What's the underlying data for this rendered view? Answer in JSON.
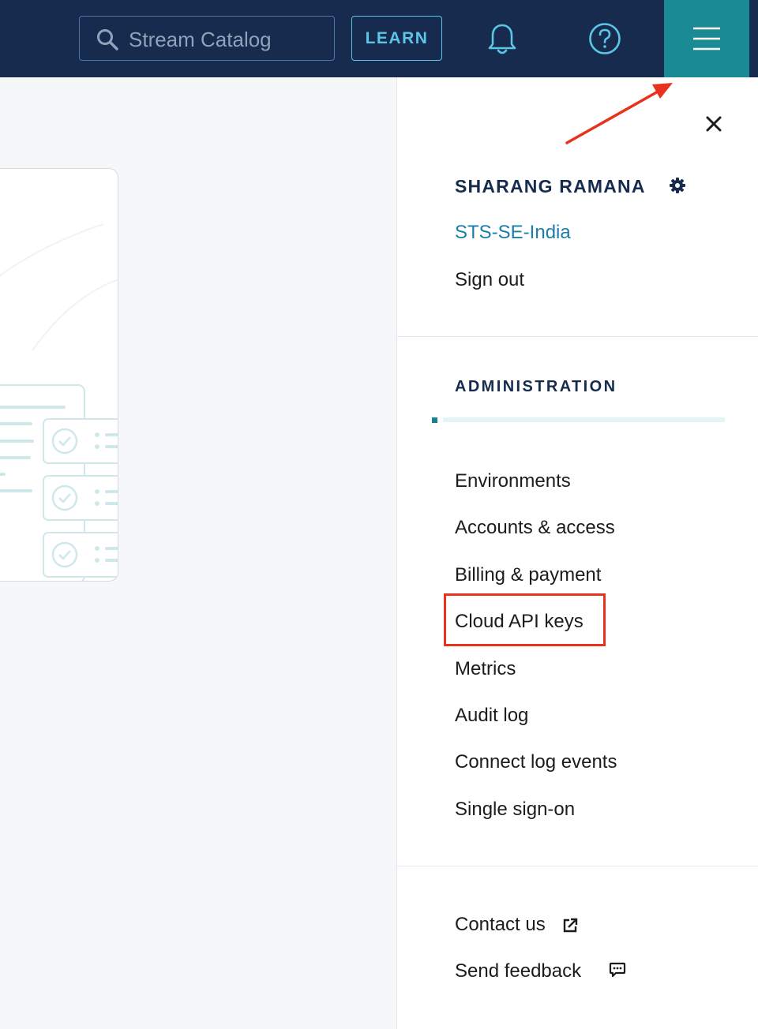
{
  "topbar": {
    "search_placeholder": "Stream Catalog",
    "learn_label": "LEARN",
    "icons": {
      "search": "search-icon",
      "notifications": "bell-icon",
      "help": "help-circle-icon",
      "menu": "hamburger-menu-icon"
    },
    "colors": {
      "bar_bg": "#162b4d",
      "menu_active_bg": "#1a8a94",
      "accent": "#5cc6e6"
    }
  },
  "panel": {
    "close_icon": "close-icon",
    "user_name": "SHARANG RAMANA",
    "settings_icon": "gear-icon",
    "organization": "STS-SE-India",
    "sign_out": "Sign out",
    "admin_heading": "ADMINISTRATION",
    "admin_items": [
      "Environments",
      "Accounts & access",
      "Billing & payment",
      "Cloud API keys",
      "Metrics",
      "Audit log",
      "Connect log events",
      "Single sign-on"
    ],
    "footer_items": [
      {
        "label": "Contact us",
        "icon": "external-link-icon"
      },
      {
        "label": "Send feedback",
        "icon": "chat-bubble-icon"
      }
    ]
  },
  "annotation": {
    "highlighted_item": "Cloud API keys",
    "arrow_target": "hamburger-menu-icon",
    "color": "#e8321e"
  }
}
